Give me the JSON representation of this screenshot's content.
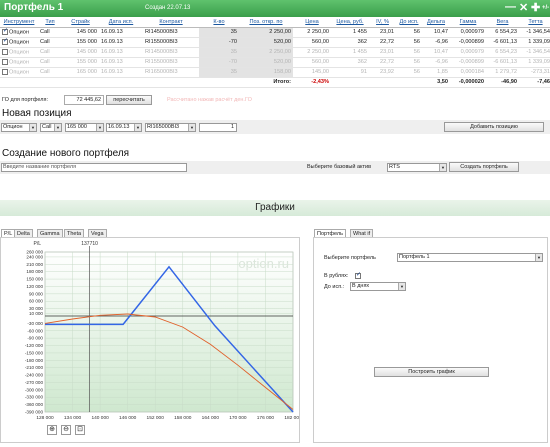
{
  "title": "Портфель 1",
  "created": "Создан 22.07.13",
  "controls": {
    "minimize": "—",
    "close": "✕",
    "add": "✚",
    "expand": "+/-"
  },
  "table": {
    "headers": [
      "Инструмент",
      "Тип",
      "Страйк",
      "Дата исп.",
      "Контракт",
      "К-во",
      "Поз. откр. по",
      "Цена",
      "Цена, руб.",
      "IV, %",
      "До исп.",
      "Дельта",
      "Гамма",
      "Вега",
      "Тетта",
      ""
    ],
    "rows": [
      {
        "checked": true,
        "enabled": true,
        "cells": [
          "Опцион",
          "Call",
          "145 000",
          "16.09.13",
          "RI145000BI3",
          "35",
          "2 250,00",
          "2 250,00",
          "1 455",
          "23,01",
          "56",
          "10,47",
          "0,000979",
          "6 554,23",
          "-1 346,54"
        ]
      },
      {
        "checked": true,
        "enabled": true,
        "cells": [
          "Опцион",
          "Call",
          "155 000",
          "16.09.13",
          "RI155000BI3",
          "-70",
          "520,00",
          "560,00",
          "362",
          "22,72",
          "56",
          "-6,96",
          "-0,000899",
          "-6 601,13",
          "1 339,09"
        ]
      },
      {
        "checked": false,
        "enabled": false,
        "cells": [
          "Опцион",
          "Call",
          "145 000",
          "16.09.13",
          "RI145000BI3",
          "35",
          "2 250,00",
          "2 250,00",
          "1 455",
          "23,01",
          "56",
          "10,47",
          "0,000979",
          "6 554,23",
          "-1 346,54"
        ]
      },
      {
        "checked": false,
        "enabled": false,
        "cells": [
          "Опцион",
          "Call",
          "155 000",
          "16.09.13",
          "RI155000BI3",
          "-70",
          "520,00",
          "560,00",
          "362",
          "22,72",
          "56",
          "-6,96",
          "-0,000899",
          "-6 601,13",
          "1 339,09"
        ]
      },
      {
        "checked": false,
        "enabled": false,
        "cells": [
          "Опцион",
          "Call",
          "165 000",
          "16.09.13",
          "RI165000BI3",
          "35",
          "158,00",
          "145,00",
          "91",
          "23,92",
          "56",
          "1,85",
          "0,000184",
          "1 279,72",
          "-273,31"
        ]
      }
    ],
    "total_label": "Итого:",
    "total_pct": "-2,43%",
    "total_delta": "3,50",
    "total_gamma": "-0,000020",
    "total_vega": "-46,90",
    "total_theta": "-7,46"
  },
  "go": {
    "label": "ГО для портфеля:",
    "value": "72 445,62",
    "recalc": "пересчитать",
    "warning": "Рассчитано нажав расчёт ден.ГО"
  },
  "new_position": {
    "title": "Новая позиция",
    "type": "Опцион",
    "kind": "Call",
    "strike": "165 000",
    "date": "16.09.13",
    "contract": "RI165000BI3",
    "qty": "1",
    "add": "Добавить позицию"
  },
  "create_portfolio": {
    "title": "Создание нового портфеля",
    "name_placeholder": "Введите название портфеля",
    "asset_label": "Выберите базовый актив",
    "asset": "RTS",
    "create": "Создать портфель"
  },
  "graphs_title": "Графики",
  "chart_tabs": [
    "P/L",
    "Delta",
    "Gamma",
    "Theta",
    "Vega"
  ],
  "right_tabs": [
    "Портфель",
    "What if"
  ],
  "right_panel": {
    "portfolio_label": "Выберите портфель",
    "portfolio": "Портфель 1",
    "rub_label": "В рублях:",
    "until_label": "До исп.:",
    "until": "В днях",
    "build": "Построить график"
  },
  "watermark": "option.ru",
  "cursor_label": "137710",
  "chart_data": {
    "type": "line",
    "title": "",
    "ylabel": "P/L",
    "xlim": [
      128000,
      182000
    ],
    "ylim": [
      -390000,
      260000
    ],
    "x_ticks": [
      128000,
      134000,
      140000,
      146000,
      152000,
      158000,
      164000,
      170000,
      176000,
      182000
    ],
    "x_tick_labels": [
      "128 000",
      "134 000",
      "140 000",
      "146 000",
      "152 000",
      "158 000",
      "164 000",
      "170 000",
      "176 000",
      "182 000"
    ],
    "y_ticks": [
      260000,
      240000,
      210000,
      180000,
      150000,
      120000,
      90000,
      60000,
      30000,
      10000,
      -30000,
      -60000,
      -90000,
      -120000,
      -150000,
      -180000,
      -210000,
      -240000,
      -270000,
      -300000,
      -330000,
      -360000,
      -390000
    ],
    "y_tick_labels": [
      "260 000",
      "240 000",
      "210 000",
      "180 000",
      "150 000",
      "120 000",
      "90 000",
      "60 000",
      "30 000",
      "10 000",
      "-30 000",
      "-60 000",
      "-90 000",
      "-120 000",
      "-150 000",
      "-180 000",
      "-210 000",
      "-240 000",
      "-270 000",
      "-300 000",
      "-330 000",
      "-360 000",
      "-390 000"
    ],
    "series": [
      {
        "color": "#3366e6",
        "x": [
          128000,
          145000,
          155000,
          165000,
          182000
        ],
        "y": [
          -34000,
          -34000,
          200000,
          -40000,
          -390000
        ]
      },
      {
        "color": "#e0602a",
        "x": [
          128000,
          134000,
          140000,
          146000,
          152000,
          158000,
          164000,
          170000,
          176000,
          182000
        ],
        "y": [
          -30000,
          -12000,
          3000,
          8000,
          -4000,
          -45000,
          -115000,
          -200000,
          -290000,
          -380000
        ]
      }
    ],
    "vline_x": 137710,
    "grid": true
  }
}
